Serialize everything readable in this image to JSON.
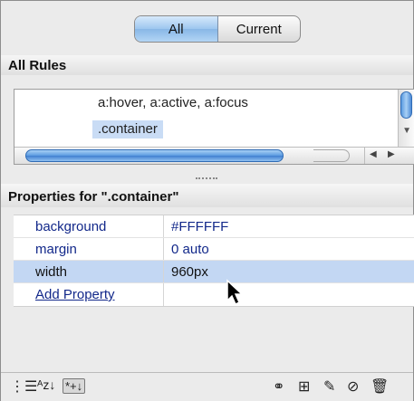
{
  "view_toggle": {
    "all_label": "All",
    "current_label": "Current"
  },
  "all_rules": {
    "title": "All Rules",
    "items": [
      "a:hover, a:active, a:focus",
      ".container"
    ]
  },
  "properties": {
    "title": "Properties for \".container\"",
    "rows": [
      {
        "name": "background",
        "value": "#FFFFFF"
      },
      {
        "name": "margin",
        "value": "0 auto"
      },
      {
        "name": "width",
        "value": "960px"
      }
    ],
    "add_label": "Add Property"
  },
  "footer": {
    "left_icons": [
      "category-view-icon",
      "alphabetical-view-icon",
      "show-set-properties-icon"
    ],
    "right_icons": [
      "attach-stylesheet-icon",
      "new-css-rule-icon",
      "edit-style-icon",
      "disable-property-icon",
      "delete-icon"
    ]
  },
  "colors": {
    "selection": "#c3d7f3",
    "link": "#12288a",
    "active_segment": "#9dc6ef"
  }
}
